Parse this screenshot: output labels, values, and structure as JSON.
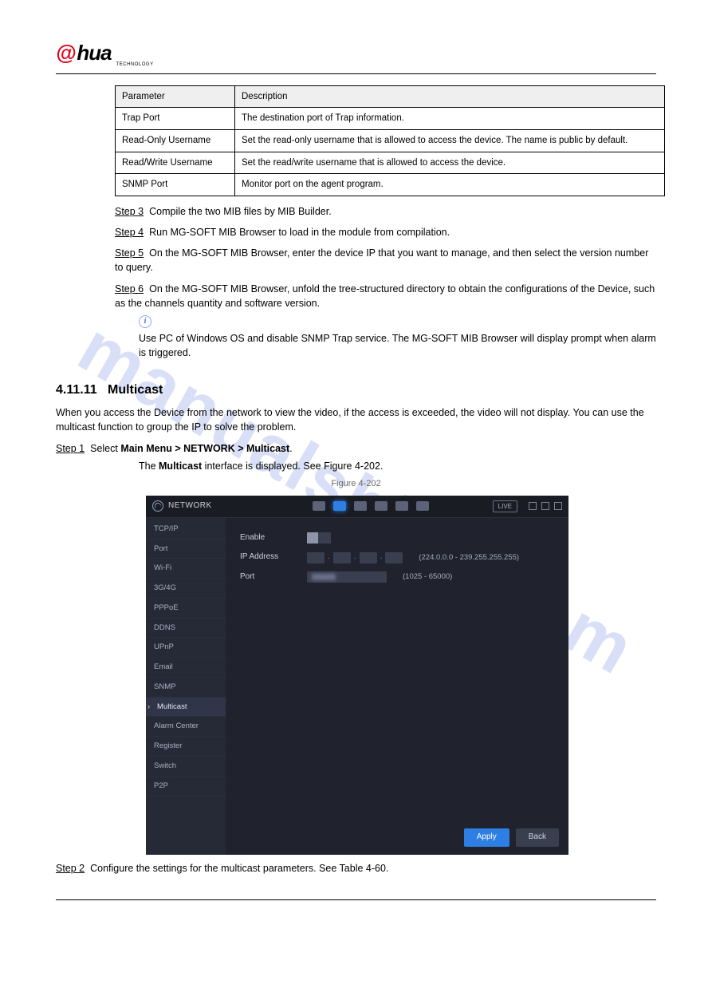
{
  "watermark": "manualshive.com",
  "logo": {
    "at": "@",
    "hua": "hua",
    "sub": "TECHNOLOGY"
  },
  "table": {
    "headers": [
      "Parameter",
      "Description"
    ],
    "rows": [
      [
        "Trap Port",
        "The destination port of Trap information."
      ],
      [
        "Read-Only Username",
        "Set the read-only username that is allowed to access the device. The name is public by default."
      ],
      [
        "Read/Write Username",
        "Set the read/write username that is allowed to access the device."
      ],
      [
        "SNMP Port",
        "Monitor port on the agent program."
      ]
    ]
  },
  "steps": {
    "s3": {
      "label": "Step 3",
      "text": "Compile the two MIB files by MIB Builder."
    },
    "s4": {
      "label": "Step 4",
      "text": "Run MG-SOFT MIB Browser to load in the module from compilation."
    },
    "s5": {
      "label": "Step 5",
      "text": "On the MG-SOFT MIB Browser, enter the device IP that you want to manage, and then select the version number to query."
    },
    "s6": {
      "label": "Step 6",
      "text": "On the MG-SOFT MIB Browser, unfold the tree-structured directory to obtain the configurations of the Device, such as the channels quantity and software version."
    },
    "tip": "Use PC of Windows OS and disable SNMP Trap service. The MG-SOFT MIB Browser will display prompt when alarm is triggered."
  },
  "section": {
    "number": "4.11.11",
    "title": "Multicast",
    "p1": "When you access the Device from the network to view the video, if the access is exceeded, the video will not display. You can use the multicast function to group the IP to solve the problem.",
    "step1": {
      "label": "Step 1",
      "text": "Select ",
      "bold": "Main Menu > NETWORK > Multicast",
      "tail": "."
    },
    "result1": {
      "prefix": "The ",
      "bold": "Multicast",
      "suffix": " interface is displayed. See Figure 4-202."
    }
  },
  "figure": {
    "caption": "Figure 4-202"
  },
  "screenshot": {
    "headerTitle": "NETWORK",
    "liveBadge": "LIVE",
    "sidebar": [
      "TCP/IP",
      "Port",
      "Wi-Fi",
      "3G/4G",
      "PPPoE",
      "DDNS",
      "UPnP",
      "Email",
      "SNMP",
      "Multicast",
      "Alarm Center",
      "Register",
      "Switch",
      "P2P"
    ],
    "activeItem": "Multicast",
    "form": {
      "enableLabel": "Enable",
      "ipLabel": "IP Address",
      "ipHint": "(224.0.0.0 - 239.255.255.255)",
      "portLabel": "Port",
      "portHint": "(1025 - 65000)"
    },
    "buttons": {
      "apply": "Apply",
      "back": "Back"
    }
  },
  "afterFig": {
    "step2": {
      "label": "Step 2",
      "text": "Configure the settings for the multicast parameters. See Table 4-60."
    }
  }
}
